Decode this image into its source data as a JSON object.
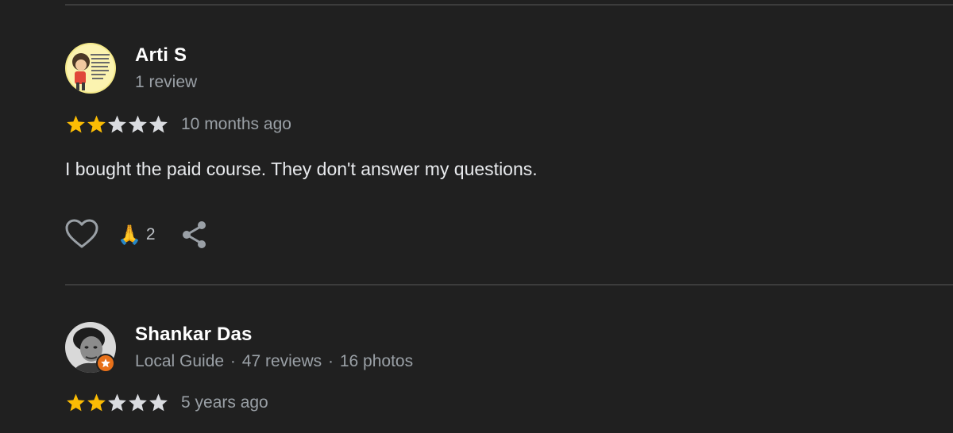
{
  "reviews": [
    {
      "reviewer_name": "Arti S",
      "reviewer_meta": "1 review",
      "avatar_icon": "cartoon-avatar-icon",
      "rating": 2,
      "max_rating": 5,
      "time": "10 months ago",
      "text": "I bought the paid course. They don't answer my questions.",
      "reaction_emoji": "🙏",
      "reaction_count": "2"
    },
    {
      "reviewer_name": "Shankar Das",
      "reviewer_meta_parts": [
        "Local Guide",
        "47 reviews",
        "16 photos"
      ],
      "meta_separator": "·",
      "avatar_icon": "photo-avatar-icon",
      "badge_icon": "local-guide-star-icon",
      "rating": 2,
      "max_rating": 5,
      "time": "5 years ago"
    }
  ],
  "colors": {
    "background": "#202020",
    "star_filled": "#fbbc04",
    "star_empty": "#dadce0",
    "secondary_text": "#9aa0a6",
    "badge": "#e8711a"
  },
  "icons": {
    "like": "heart-outline-icon",
    "share": "share-icon"
  }
}
